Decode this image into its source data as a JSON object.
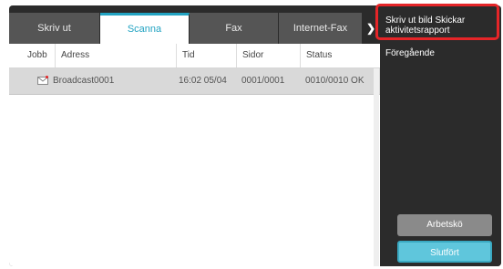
{
  "tabs": [
    {
      "label": "Skriv ut",
      "active": false
    },
    {
      "label": "Scanna",
      "active": true
    },
    {
      "label": "Fax",
      "active": false
    },
    {
      "label": "Internet-Fax",
      "active": false
    }
  ],
  "tab_more_icon": "chevron-right",
  "table": {
    "headers": [
      "Jobb",
      "Adress",
      "Tid",
      "Sidor",
      "Status"
    ],
    "rows": [
      {
        "icon": "mail-icon",
        "address": "Broadcast0001",
        "time": "16:02 05/04",
        "pages": "0001/0001",
        "status": "0010/0010 OK"
      }
    ]
  },
  "side_menu": {
    "print_report_label": "Skriv ut bild Skickar aktivitetsrapport",
    "previous_label": "Föregående",
    "job_queue_label": "Arbetskö",
    "done_label": "Slutfört"
  },
  "colors": {
    "accent": "#22a3c2",
    "highlight": "#e52528",
    "panel_dark": "#2b2b2b",
    "done_button": "#5fc6dc"
  }
}
